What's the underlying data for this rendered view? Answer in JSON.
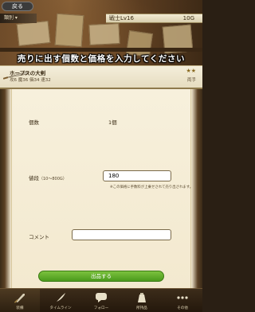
{
  "header": {
    "back_label": "戻る",
    "category_tab": "類別 ▾",
    "job": "戦士Lv16",
    "gold": "10G"
  },
  "banner": {
    "text": "売りに出す個数と価格を入力してください"
  },
  "item": {
    "name": "ホープスの大剣",
    "stats": "攻6 魔36 価34 速32",
    "rarity": "★★",
    "type": "両手"
  },
  "form": {
    "quantity_label": "個数",
    "quantity_value": "1個",
    "price_label": "値段",
    "price_range": "（10～800G）",
    "price_value": "180",
    "price_note": "※この価格に手数料が上乗せされて売り出されます。",
    "comment_label": "コメント",
    "comment_value": "",
    "submit_label": "出品する"
  },
  "nav": {
    "items": [
      {
        "label": "装備",
        "icon": "sword-icon"
      },
      {
        "label": "タイムライン",
        "icon": "quill-icon"
      },
      {
        "label": "フォロー",
        "icon": "chat-icon"
      },
      {
        "label": "所持品",
        "icon": "bag-icon"
      },
      {
        "label": "その他",
        "icon": "more-icon"
      }
    ]
  }
}
